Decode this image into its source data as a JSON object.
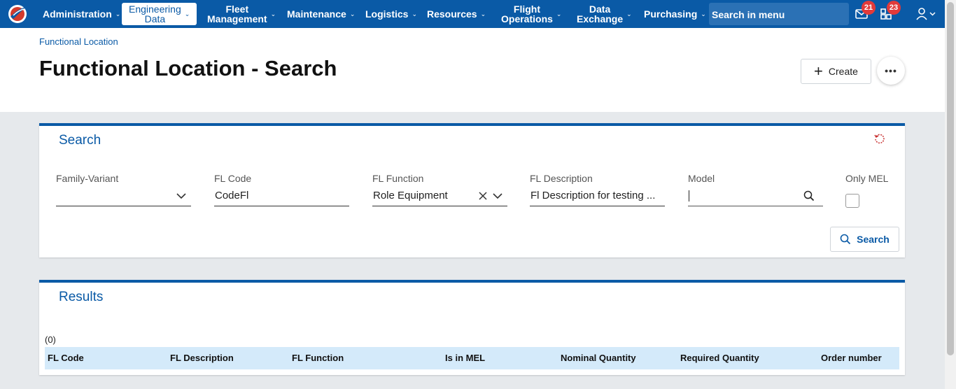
{
  "colors": {
    "brand": "#0a5aa6",
    "badge": "#e23a3a",
    "table_header_bg": "#d4eafa"
  },
  "nav": {
    "items": [
      {
        "label": "Administration"
      },
      {
        "label": "Engineering\nData",
        "active": true
      },
      {
        "label": "Fleet\nManagement"
      },
      {
        "label": "Maintenance"
      },
      {
        "label": "Logistics"
      },
      {
        "label": "Resources"
      },
      {
        "label": "Flight\nOperations"
      },
      {
        "label": "Data\nExchange"
      },
      {
        "label": "Purchasing"
      }
    ],
    "search_placeholder": "Search in menu",
    "mail_count": "21",
    "tasks_count": "23"
  },
  "breadcrumb": "Functional Location",
  "page_title": "Functional Location - Search",
  "actions": {
    "create_label": "Create"
  },
  "search": {
    "title": "Search",
    "fields": [
      {
        "label": "Family-Variant",
        "value": ""
      },
      {
        "label": "FL Code",
        "value": "CodeFl"
      },
      {
        "label": "FL Function",
        "value": "Role Equipment"
      },
      {
        "label": "FL Description",
        "value": "Fl Description for testing ..."
      },
      {
        "label": "Model",
        "value": ""
      },
      {
        "label": "Only MEL",
        "checked": false
      }
    ],
    "button_label": "Search"
  },
  "results": {
    "title": "Results",
    "count": "(0)",
    "columns": [
      "FL Code",
      "FL Description",
      "FL Function",
      "Is in MEL",
      "Nominal Quantity",
      "Required Quantity",
      "Order number"
    ]
  }
}
